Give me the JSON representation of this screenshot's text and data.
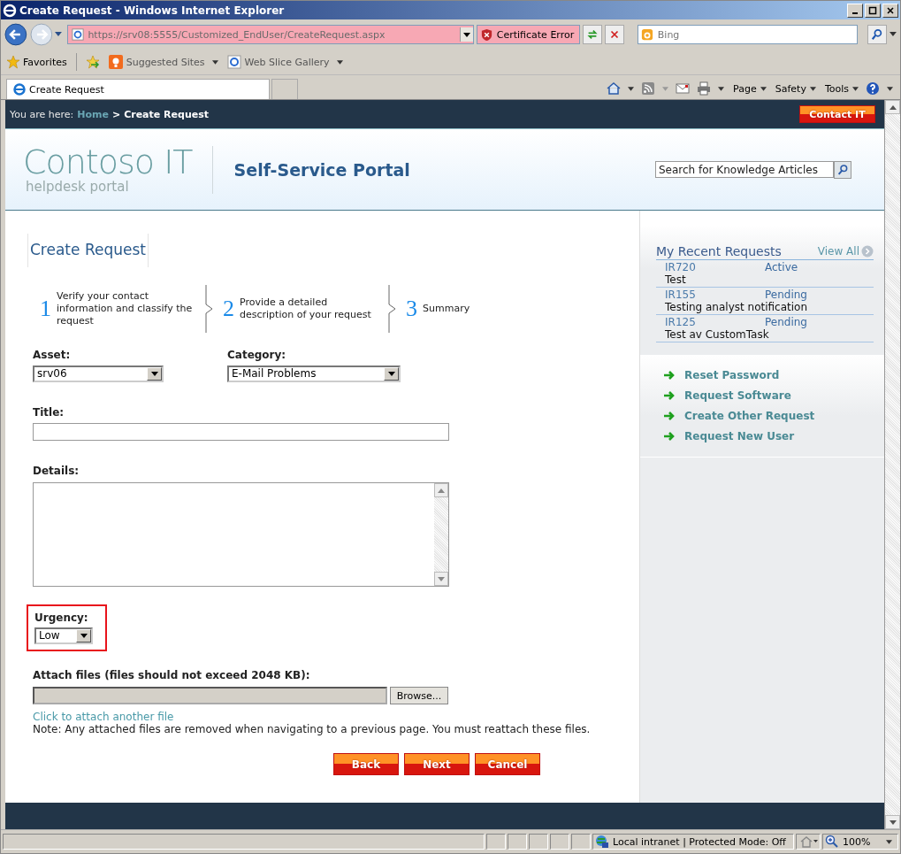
{
  "window": {
    "title": "Create Request - Windows Internet Explorer"
  },
  "address_bar": {
    "url": "https://srv08:5555/Customized_EndUser/CreateRequest.aspx",
    "certificate": "Certificate Error",
    "search_placeholder": "Bing"
  },
  "favorites_bar": {
    "label": "Favorites",
    "items": [
      "Suggested Sites",
      "Web Slice Gallery"
    ]
  },
  "tabs": [
    {
      "label": "Create Request",
      "selected": true
    }
  ],
  "command_bar": [
    "Page",
    "Safety",
    "Tools"
  ],
  "nav": {
    "label": "You are here:",
    "home": "Home",
    "separator": ">",
    "current": "Create Request",
    "contact": "Contact IT"
  },
  "header": {
    "logo": "Contoso IT",
    "tagline": "helpdesk portal",
    "title": "Self-Service Portal",
    "search_placeholder": "Search for Knowledge Articles"
  },
  "heading": "Create Request",
  "steps": [
    {
      "number": "1",
      "text": "Verify your contact information and classify the request"
    },
    {
      "number": "2",
      "text": "Provide a detailed description of your request"
    },
    {
      "number": "3",
      "text": "Summary"
    }
  ],
  "form": {
    "asset": {
      "label": "Asset:",
      "value": "srv06"
    },
    "category": {
      "label": "Category:",
      "value": "E-Mail Problems"
    },
    "title": {
      "label": "Title:"
    },
    "details": {
      "label": "Details:"
    },
    "urgency": {
      "label": "Urgency:",
      "value": "Low",
      "highlighted": true
    },
    "attach": {
      "label": "Attach files (files should not exceed 2048 KB):",
      "browse": "Browse...",
      "link": "Click to attach another file",
      "note": "Note: Any attached files are removed when navigating to a previous page. You must reattach these files."
    },
    "buttons": [
      "Back",
      "Next",
      "Cancel"
    ]
  },
  "sidebar": {
    "title": "My Recent Requests",
    "view_all": "View All",
    "requests": [
      {
        "id": "IR720",
        "status": "Active",
        "title": "Test"
      },
      {
        "id": "IR155",
        "status": "Pending",
        "title": "Testing analyst notification"
      },
      {
        "id": "IR125",
        "status": "Pending",
        "title": "Test av CustomTask"
      }
    ],
    "links": [
      "Reset Password",
      "Request Software",
      "Create Other Request",
      "Request New User"
    ]
  },
  "status_bar": {
    "zone": "Local intranet | Protected Mode: Off",
    "zoom": "100%"
  }
}
